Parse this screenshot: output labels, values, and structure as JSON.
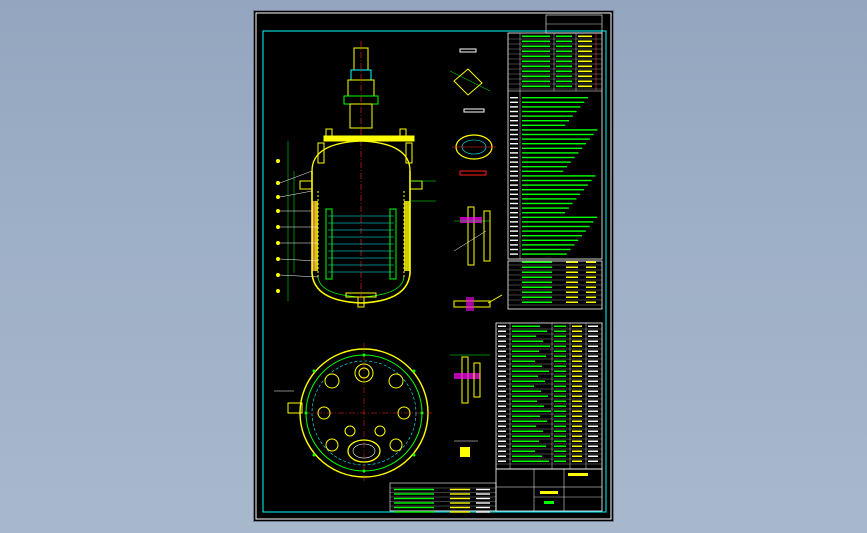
{
  "window": {
    "background_top": "#94a6bf",
    "background_bottom": "#a8b8cc"
  },
  "drawing": {
    "sheet_color": "#000000",
    "line_colors": {
      "yellow": "#ffff00",
      "green": "#00ff00",
      "cyan": "#00ffff",
      "white": "#ffffff",
      "red": "#ff2020",
      "magenta": "#ff00ff",
      "blue": "#2a4bff"
    },
    "layers": [
      "elevation-view",
      "plan-view",
      "detail-views",
      "specification-table",
      "parts-list",
      "title-block"
    ]
  }
}
